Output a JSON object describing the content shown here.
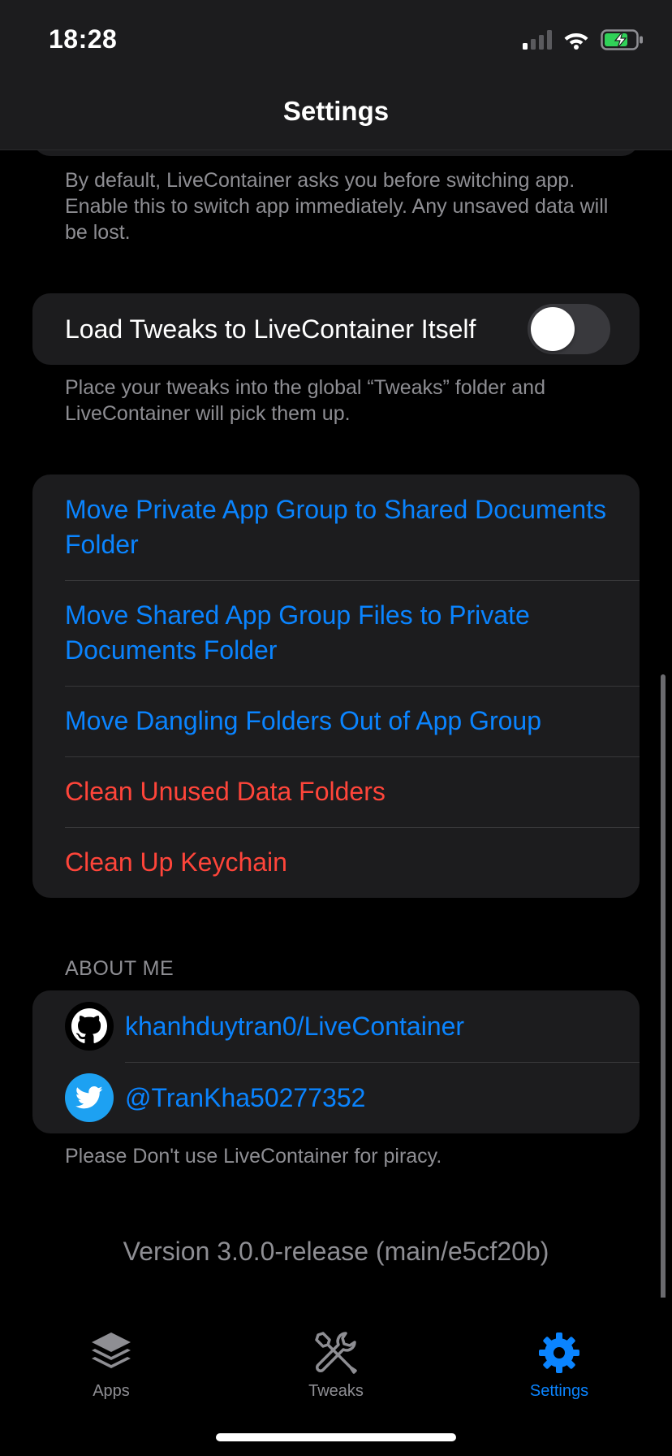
{
  "status_bar": {
    "time": "18:28"
  },
  "nav": {
    "title": "Settings"
  },
  "sections": {
    "switch_footer": "By default, LiveContainer asks you before switching app. Enable this to switch app immediately. Any unsaved data will be lost.",
    "tweaks": {
      "toggle_label": "Load Tweaks to LiveContainer Itself",
      "toggle_on": false,
      "footer": "Place your tweaks into the global “Tweaks” folder and LiveContainer will pick them up."
    },
    "actions": [
      {
        "label": "Move Private App Group to Shared Documents Folder",
        "color": "#0a84ff"
      },
      {
        "label": "Move Shared App Group Files to Private Documents Folder",
        "color": "#0a84ff"
      },
      {
        "label": "Move Dangling Folders Out of App Group",
        "color": "#0a84ff"
      },
      {
        "label": "Clean Unused Data Folders",
        "color": "#ff453a"
      },
      {
        "label": "Clean Up Keychain",
        "color": "#ff453a"
      }
    ],
    "about": {
      "header": "ABOUT ME",
      "github_link": "khanhduytran0/LiveContainer",
      "twitter_link": "@TranKha50277352",
      "footer": "Please Don't use LiveContainer for piracy."
    }
  },
  "version": "Version 3.0.0-release (main/e5cf20b)",
  "tab_bar": {
    "tabs": [
      {
        "label": "Apps",
        "icon": "stack-icon",
        "active": false
      },
      {
        "label": "Tweaks",
        "icon": "wrench-screwdriver-icon",
        "active": false
      },
      {
        "label": "Settings",
        "icon": "gear-icon",
        "active": true
      }
    ]
  },
  "colors": {
    "accent": "#0a84ff",
    "destructive": "#ff453a",
    "background": "#000000",
    "card": "#1c1c1e"
  }
}
